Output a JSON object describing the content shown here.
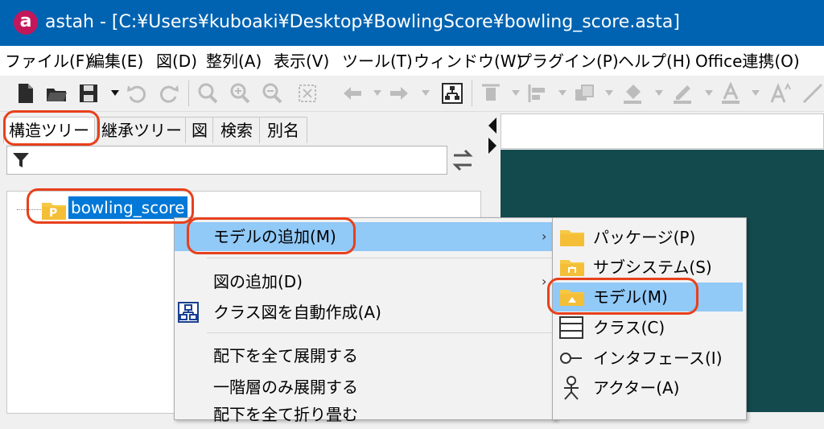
{
  "window": {
    "app_name": "astah",
    "title": "astah - [C:¥Users¥kuboaki¥Desktop¥BowlingScore¥bowling_score.asta]",
    "icon_letter": "a"
  },
  "menubar": {
    "items": [
      "ファイル(F)",
      "編集(E)",
      "図(D)",
      "整列(A)",
      "表示(V)",
      "ツール(T)",
      "ウィンドウ(W)",
      "プラグイン(P)",
      "ヘルプ(H)",
      "Office連携(O)"
    ]
  },
  "left_panel": {
    "tabs": [
      "構造ツリー",
      "継承ツリー",
      "図",
      "検索",
      "別名"
    ],
    "active_tab": "構造ツリー",
    "filter": {
      "value": "",
      "placeholder": ""
    },
    "tree": {
      "root_label": "bowling_score",
      "root_icon_letter": "P"
    }
  },
  "context_menu": {
    "items": [
      {
        "label": "モデルの追加(M)",
        "has_submenu": true,
        "highlighted": true
      },
      {
        "label": "図の追加(D)",
        "has_submenu": true
      },
      {
        "label": "クラス図を自動作成(A)",
        "icon": "class-diagram-icon"
      },
      {
        "label": "配下を全て展開する"
      },
      {
        "label": "一階層のみ展開する"
      },
      {
        "label": "配下を全て折り畳む"
      }
    ]
  },
  "submenu": {
    "items": [
      {
        "label": "パッケージ(P)",
        "icon": "package-folder-icon"
      },
      {
        "label": "サブシステム(S)",
        "icon": "subsystem-folder-icon"
      },
      {
        "label": "モデル(M)",
        "icon": "model-folder-icon",
        "highlighted": true
      },
      {
        "label": "クラス(C)",
        "icon": "class-icon"
      },
      {
        "label": "インタフェース(I)",
        "icon": "interface-icon"
      },
      {
        "label": "アクター(A)",
        "icon": "actor-icon"
      }
    ]
  },
  "colors": {
    "titlebar": "#0063b1",
    "highlight": "#91c9f7",
    "selection": "#0078d7",
    "annotation_ring": "#e8401c",
    "diagram_background": "#134a4e",
    "folder": "#f6c844"
  }
}
